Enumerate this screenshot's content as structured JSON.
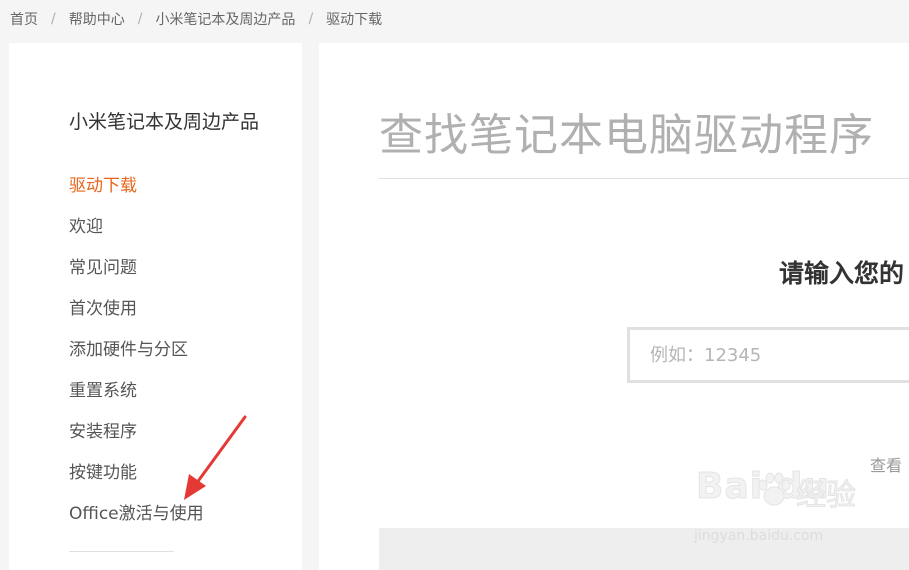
{
  "breadcrumb": {
    "items": [
      "首页",
      "帮助中心",
      "小米笔记本及周边产品"
    ],
    "separator": "/",
    "current": "驱动下载"
  },
  "sidebar": {
    "title": "小米笔记本及周边产品",
    "items": [
      {
        "label": "驱动下载",
        "active": true
      },
      {
        "label": "欢迎"
      },
      {
        "label": "常见问题"
      },
      {
        "label": "首次使用"
      },
      {
        "label": "添加硬件与分区"
      },
      {
        "label": "重置系统"
      },
      {
        "label": "安装程序"
      },
      {
        "label": "按键功能"
      },
      {
        "label": "Office激活与使用"
      }
    ]
  },
  "main": {
    "title": "查找笔记本电脑驱动程序",
    "prompt": "请输入您的",
    "search": {
      "placeholder": "例如：12345",
      "value": ""
    },
    "view_link": "查看"
  },
  "watermark": {
    "logo_text": "Bai  du",
    "brand_cn": "经验",
    "url": "jingyan.baidu.com"
  },
  "colors": {
    "accent": "#e8651b",
    "annotation_arrow": "#e53935",
    "page_bg": "#f5f5f5"
  }
}
